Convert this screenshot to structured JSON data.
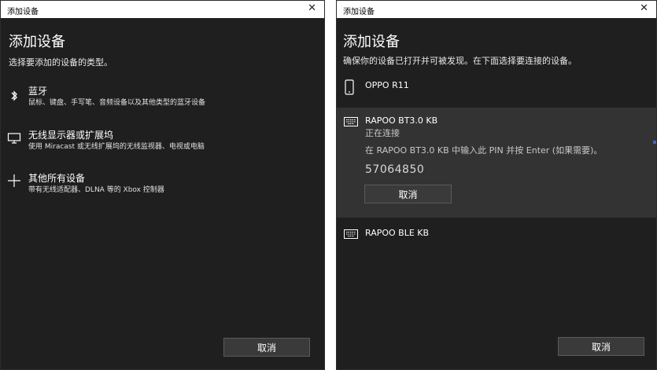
{
  "left": {
    "title": "添加设备",
    "close": "✕",
    "heading": "添加设备",
    "subtitle": "选择要添加的设备的类型。",
    "options": [
      {
        "name": "蓝牙",
        "desc": "鼠标、键盘、手写笔、音频设备以及其他类型的蓝牙设备",
        "icon": "bluetooth-icon"
      },
      {
        "name": "无线显示器或扩展坞",
        "desc": "使用 Miracast 或无线扩展坞的无线监视器、电视或电脑",
        "icon": "monitor-icon"
      },
      {
        "name": "其他所有设备",
        "desc": "带有无线适配器、DLNA 等的 Xbox 控制器",
        "icon": "plus-icon"
      }
    ],
    "cancel": "取消"
  },
  "right": {
    "title": "添加设备",
    "close": "✕",
    "heading": "添加设备",
    "subtitle": "确保你的设备已打开并可被发现。在下面选择要连接的设备。",
    "devices": [
      {
        "name": "OPPO R11",
        "icon": "phone-icon"
      },
      {
        "name": "RAPOO BT3.0 KB",
        "icon": "keyboard-icon",
        "status": "正在连接",
        "instruction": "在 RAPOO BT3.0 KB 中输入此 PIN 并按 Enter (如果需要)。",
        "pin": "57064850",
        "cancel": "取消"
      },
      {
        "name": "RAPOO BLE KB",
        "icon": "keyboard-icon"
      }
    ],
    "cancel": "取消"
  },
  "colors": {
    "window_bg": "#1f1f1f",
    "selected_bg": "#333333",
    "button_bg": "#3a3a3a",
    "accent": "#2d6cdf"
  }
}
